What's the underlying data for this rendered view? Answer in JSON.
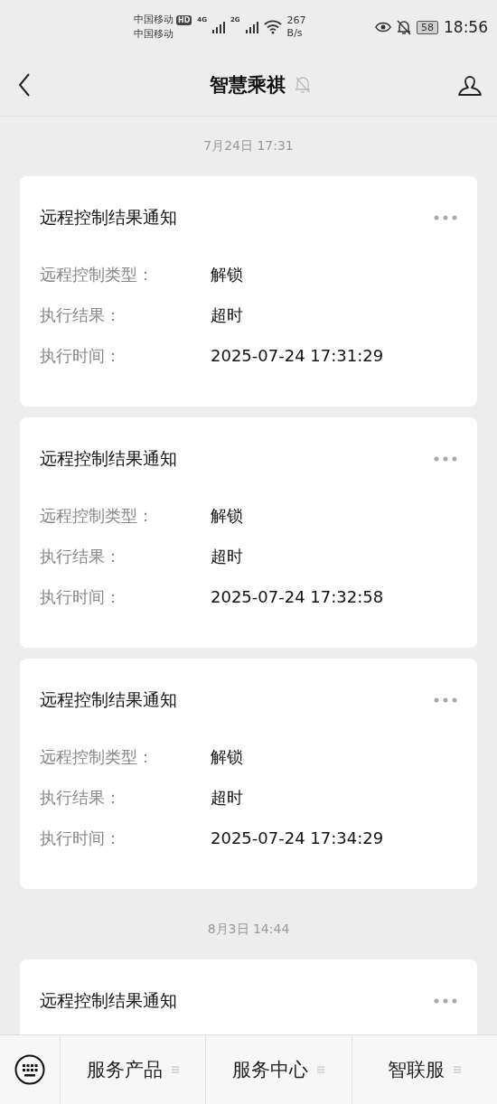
{
  "status_bar": {
    "carriers": [
      "中国移动",
      "中国移动"
    ],
    "hd": "HD",
    "networks": [
      "4G",
      "2G"
    ],
    "speed": "267",
    "speed_unit": "B/s",
    "battery": "58",
    "time": "18:56"
  },
  "header": {
    "title": "智慧乘祺",
    "muted": true
  },
  "feed": [
    {
      "kind": "date",
      "text": "7月24日 17:31"
    },
    {
      "kind": "card",
      "title": "远程控制结果通知",
      "rows": [
        {
          "label": "远程控制类型：",
          "value": "解锁"
        },
        {
          "label": "执行结果：",
          "value": "超时"
        },
        {
          "label": "执行时间：",
          "value": "2025-07-24 17:31:29"
        }
      ]
    },
    {
      "kind": "card",
      "title": "远程控制结果通知",
      "rows": [
        {
          "label": "远程控制类型：",
          "value": "解锁"
        },
        {
          "label": "执行结果：",
          "value": "超时"
        },
        {
          "label": "执行时间：",
          "value": "2025-07-24 17:32:58"
        }
      ]
    },
    {
      "kind": "card",
      "title": "远程控制结果通知",
      "rows": [
        {
          "label": "远程控制类型：",
          "value": "解锁"
        },
        {
          "label": "执行结果：",
          "value": "超时"
        },
        {
          "label": "执行时间：",
          "value": "2025-07-24 17:34:29"
        }
      ]
    },
    {
      "kind": "date",
      "text": "8月3日 14:44"
    },
    {
      "kind": "card",
      "title": "远程控制结果通知"
    }
  ],
  "menu_bar": {
    "items": [
      "服务产品",
      "服务中心",
      "智联服"
    ]
  }
}
